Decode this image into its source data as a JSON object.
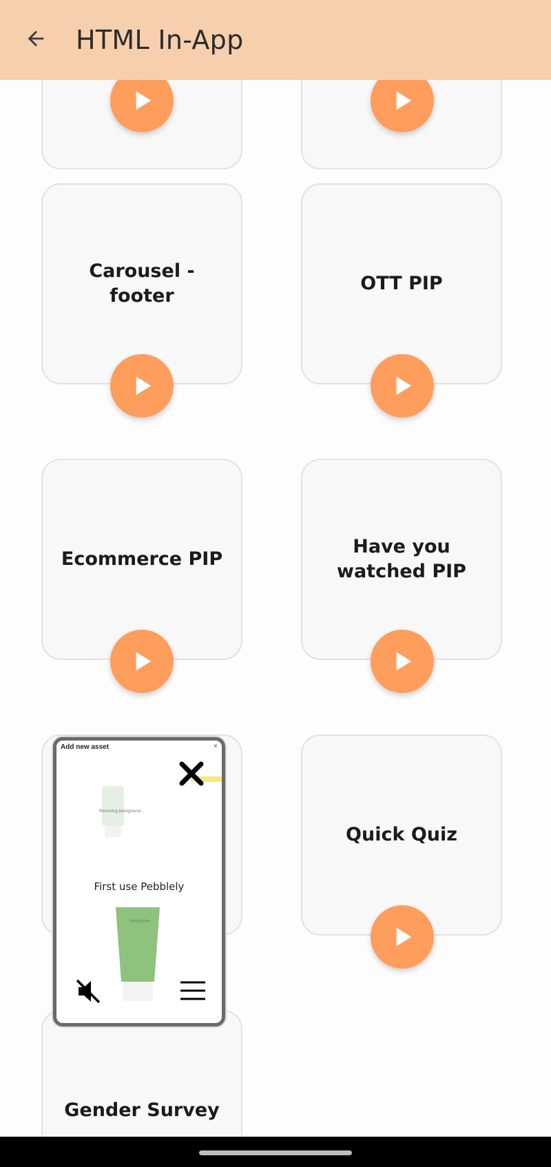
{
  "appbar": {
    "title": "HTML In-App",
    "back_icon": "arrow-left-icon"
  },
  "colors": {
    "appbar_bg": "#f6cfac",
    "play_button": "#ff9d5c",
    "card_bg": "#f8f8f8",
    "card_border": "#e2e2e2"
  },
  "cards": [
    {
      "label": ""
    },
    {
      "label": ""
    },
    {
      "label": "Carousel - footer"
    },
    {
      "label": "OTT PIP"
    },
    {
      "label": "Ecommerce PIP"
    },
    {
      "label": "Have you watched PIP"
    },
    {
      "label": ""
    },
    {
      "label": "Quick Quiz"
    },
    {
      "label": "Gender Survey"
    }
  ],
  "pip": {
    "header": "Add new asset",
    "header_close": "×",
    "small_note": "Removing background...",
    "caption": "First use Pebblely",
    "icons": [
      "close-icon",
      "mute-icon",
      "menu-icon"
    ]
  }
}
